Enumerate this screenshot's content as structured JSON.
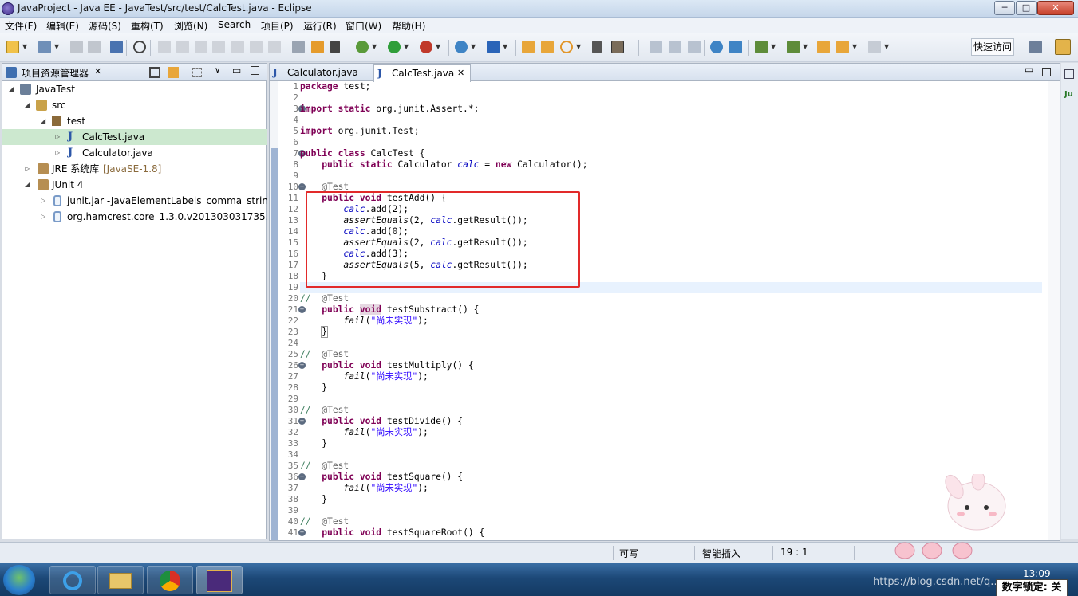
{
  "window": {
    "title": "JavaProject - Java EE - JavaTest/src/test/CalcTest.java - Eclipse",
    "min": "─",
    "max": "□",
    "close": "✕"
  },
  "menu": [
    "文件(F)",
    "编辑(E)",
    "源码(S)",
    "重构(T)",
    "浏览(N)",
    "Search",
    "项目(P)",
    "运行(R)",
    "窗口(W)",
    "帮助(H)"
  ],
  "toolbar": {
    "quick_access": "快速访问"
  },
  "project_explorer": {
    "title": "项目资源管理器",
    "close": "✕",
    "nodes": [
      {
        "label": "JavaTest",
        "decor": ""
      },
      {
        "label": "src",
        "decor": ""
      },
      {
        "label": "test",
        "decor": ""
      },
      {
        "label": "CalcTest.java",
        "decor": ""
      },
      {
        "label": "Calculator.java",
        "decor": ""
      },
      {
        "label": "JRE 系统库",
        "decor": "[JavaSE-1.8]"
      },
      {
        "label": "JUnit 4",
        "decor": ""
      },
      {
        "label": "junit.jar -JavaElementLabels_comma_string-",
        "decor": ""
      },
      {
        "label": "org.hamcrest.core_1.3.0.v201303031735.jar",
        "decor": ""
      }
    ]
  },
  "editor": {
    "tabs": [
      {
        "label": "Calculator.java"
      },
      {
        "label": "CalcTest.java",
        "close": "✕"
      }
    ],
    "line_numbers": [
      "1",
      "2",
      "3",
      "4",
      "5",
      "6",
      "7",
      "8",
      "9",
      "10",
      "11",
      "12",
      "13",
      "14",
      "15",
      "16",
      "17",
      "18",
      "19",
      "20",
      "21",
      "22",
      "23",
      "24",
      "25",
      "26",
      "27",
      "28",
      "29",
      "30",
      "31",
      "32",
      "33",
      "34",
      "35",
      "36",
      "37",
      "38",
      "39",
      "40",
      "41"
    ],
    "tokens": {
      "package": "package",
      "import": "import",
      "static": "static",
      "public": "public",
      "class": "class",
      "void": "void",
      "new": "new",
      "test_ann": "@Test",
      "comment": "//",
      "calc": "calc",
      "assertEquals": "assertEquals",
      "fail": "fail",
      "cn_str": "\"尚未实现\""
    },
    "text": {
      "l1": " test;",
      "l3": " org.junit.Assert.*;",
      "l5": " org.junit.Test;",
      "l7": " CalcTest {",
      "l8a": " Calculator ",
      "l8b": " = ",
      "l8c": " Calculator();",
      "l11": " testAdd() {",
      "add2": ".add(2);",
      "add0": ".add(0);",
      "add3": ".add(3);",
      "eq2": "(2, ",
      "eq5": "(5, ",
      "getres": ".getResult());",
      "close_brace": "}",
      "m21": " testSubstract() {",
      "m26": " testMultiply() {",
      "m31": " testDivide() {",
      "m36": " testSquare() {",
      "m41": " testSquareRoot() {",
      "failtail": ");"
    }
  },
  "status": {
    "writable": "可写",
    "insert_mode": "智能插入",
    "position": "19 : 1"
  },
  "taskbar": {
    "time": "13:09",
    "numlock": "数字锁定: 关",
    "watermark": "https://blog.csdn.net/q..."
  },
  "colors": {
    "keyword": "#7f0055",
    "field": "#0000c0",
    "string": "#2a00ff",
    "annotation": "#646464",
    "highlight_box": "#e22a2a",
    "selected_row": "#cce8cf"
  }
}
